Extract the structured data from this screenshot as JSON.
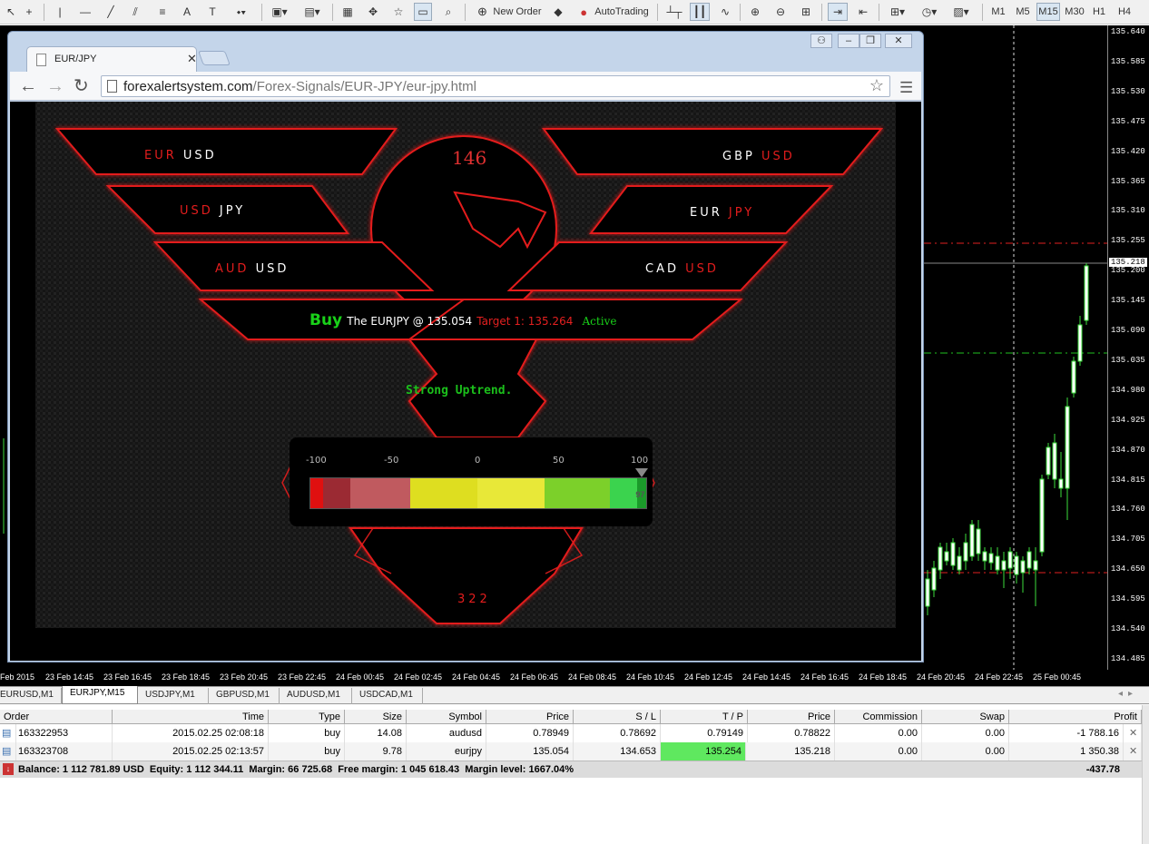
{
  "toolbar": {
    "new_order": "New Order",
    "auto_trading": "AutoTrading",
    "timeframes": [
      "M1",
      "M5",
      "M15",
      "M30",
      "H1",
      "H4"
    ],
    "active_timeframe": "M15"
  },
  "chart": {
    "price_labels": [
      "135.640",
      "135.585",
      "135.530",
      "135.475",
      "135.420",
      "135.365",
      "135.310",
      "135.255",
      "135.200",
      "135.145",
      "135.090",
      "135.035",
      "134.980",
      "134.925",
      "134.870",
      "134.815",
      "134.760",
      "134.705",
      "134.650",
      "134.595",
      "134.540",
      "134.485"
    ],
    "current_price": "135.218",
    "time_labels": [
      "Feb 2015",
      "23 Feb 14:45",
      "23 Feb 16:45",
      "23 Feb 18:45",
      "23 Feb 20:45",
      "23 Feb 22:45",
      "24 Feb 00:45",
      "24 Feb 02:45",
      "24 Feb 04:45",
      "24 Feb 06:45",
      "24 Feb 08:45",
      "24 Feb 10:45",
      "24 Feb 12:45",
      "24 Feb 14:45",
      "24 Feb 16:45",
      "24 Feb 18:45",
      "24 Feb 20:45",
      "24 Feb 22:45",
      "25 Feb 00:45"
    ]
  },
  "browser": {
    "tab_title": "EUR/JPY",
    "url_host": "forexalertsystem.com",
    "url_path": "/Forex-Signals/EUR-JPY/eur-jpy.html",
    "page": {
      "pairs_left": [
        {
          "a": "EUR",
          "b": "USD"
        },
        {
          "a": "USD",
          "b": "JPY"
        },
        {
          "a": "AUD",
          "b": "USD"
        }
      ],
      "pairs_right": [
        {
          "a": "GBP",
          "b": "USD"
        },
        {
          "a": "EUR",
          "b": "JPY"
        },
        {
          "a": "CAD",
          "b": "USD"
        }
      ],
      "top_number": "146",
      "signal_word": "Buy",
      "signal_text": "The EURJPY @ 135.054",
      "target_text": "Target 1: 135.264",
      "status_text": "Active",
      "trend_text": "Strong Uptrend.",
      "gauge": {
        "ticks": [
          "-100",
          "-50",
          "0",
          "50",
          "100"
        ],
        "value": 97,
        "value_label": "97"
      },
      "bottom_number": "322"
    }
  },
  "chart_tabs": [
    "EURUSD,M1",
    "EURJPY,M15",
    "USDJPY,M1",
    "GBPUSD,M1",
    "AUDUSD,M1",
    "USDCAD,M1"
  ],
  "active_chart_tab": "EURJPY,M15",
  "terminal": {
    "columns": [
      "Order",
      "Time",
      "Type",
      "Size",
      "Symbol",
      "Price",
      "S / L",
      "T / P",
      "Price",
      "Commission",
      "Swap",
      "Profit"
    ],
    "rows": [
      {
        "order": "163322953",
        "time": "2015.02.25 02:08:18",
        "type": "buy",
        "size": "14.08",
        "symbol": "audusd",
        "price": "0.78949",
        "sl": "0.78692",
        "tp": "0.79149",
        "cur_price": "0.78822",
        "commission": "0.00",
        "swap": "0.00",
        "profit": "-1 788.16"
      },
      {
        "order": "163323708",
        "time": "2015.02.25 02:13:57",
        "type": "buy",
        "size": "9.78",
        "symbol": "eurjpy",
        "price": "135.054",
        "sl": "134.653",
        "tp": "135.254",
        "cur_price": "135.218",
        "commission": "0.00",
        "swap": "0.00",
        "profit": "1 350.38"
      }
    ],
    "summary": "Balance: 1 112 781.89 USD  Equity: 1 112 344.11  Margin: 66 725.68  Free margin: 1 045 618.43  Margin level: 1667.04%",
    "summary_profit": "-437.78",
    "tp_highlight": "#5fe85f"
  },
  "colors": {
    "bull": "#3cdc3c",
    "red": "#e31d1d",
    "green_text": "#19d219"
  }
}
